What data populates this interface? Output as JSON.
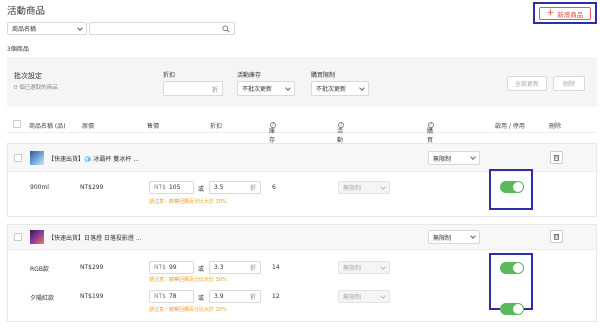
{
  "page": {
    "title": "活動商品",
    "add_label": "新增商品",
    "count_text": "3個商品"
  },
  "search": {
    "field_select": "商品名稱",
    "placeholder": ""
  },
  "batch": {
    "title": "批次設定",
    "subtitle": "0 個已選取的商品",
    "discount_label": "折扣",
    "discount_unit": "折",
    "stock_label": "活動庫存",
    "stock_value": "不批次更新",
    "limit_label": "購買限制",
    "limit_value": "不批次更新",
    "update_all": "全部更新",
    "delete": "刪除"
  },
  "columns": {
    "name": "商品名稱 (品)",
    "orig_price": "原價",
    "sale_price": "售價",
    "discount": "折扣",
    "stock": "庫存",
    "campaign_stock": "活動庫存",
    "limit": "購買限制",
    "enable": "啟用 / 停用",
    "delete": "刪除"
  },
  "products": [
    {
      "name": "【快速出貨】🧊 冰霸杯 雙冰杯 ...",
      "limit": "無限制",
      "variants": [
        {
          "name": "900ml",
          "orig_price": "NT$299",
          "currency": "NT$",
          "price": "105",
          "or": "或",
          "discount": "3.5",
          "unit": "折",
          "stock": "6",
          "campaign_stock": "無限制",
          "warn": "請注意：觀察回購百分比大於 30%",
          "enabled": true
        }
      ]
    },
    {
      "name": "【快速出貨】日落燈 日落投影燈 ...",
      "limit": "無限制",
      "variants": [
        {
          "name": "RGB款",
          "orig_price": "NT$299",
          "currency": "NT$",
          "price": "99",
          "or": "或",
          "discount": "3.3",
          "unit": "折",
          "stock": "14",
          "campaign_stock": "無限制",
          "warn": "請注意：觀察回購百分比大於 30%",
          "enabled": true
        },
        {
          "name": "夕陽紅款",
          "orig_price": "NT$199",
          "currency": "NT$",
          "price": "78",
          "or": "或",
          "discount": "3.9",
          "unit": "折",
          "stock": "12",
          "campaign_stock": "無限制",
          "warn": "請注意：觀察回購百分比大於 30%",
          "enabled": true
        }
      ]
    }
  ],
  "colors": {
    "accent": "#e04a3c",
    "toggle_on": "#5cb85c",
    "highlight": "#2b2fa8",
    "warn": "#f0a020"
  }
}
